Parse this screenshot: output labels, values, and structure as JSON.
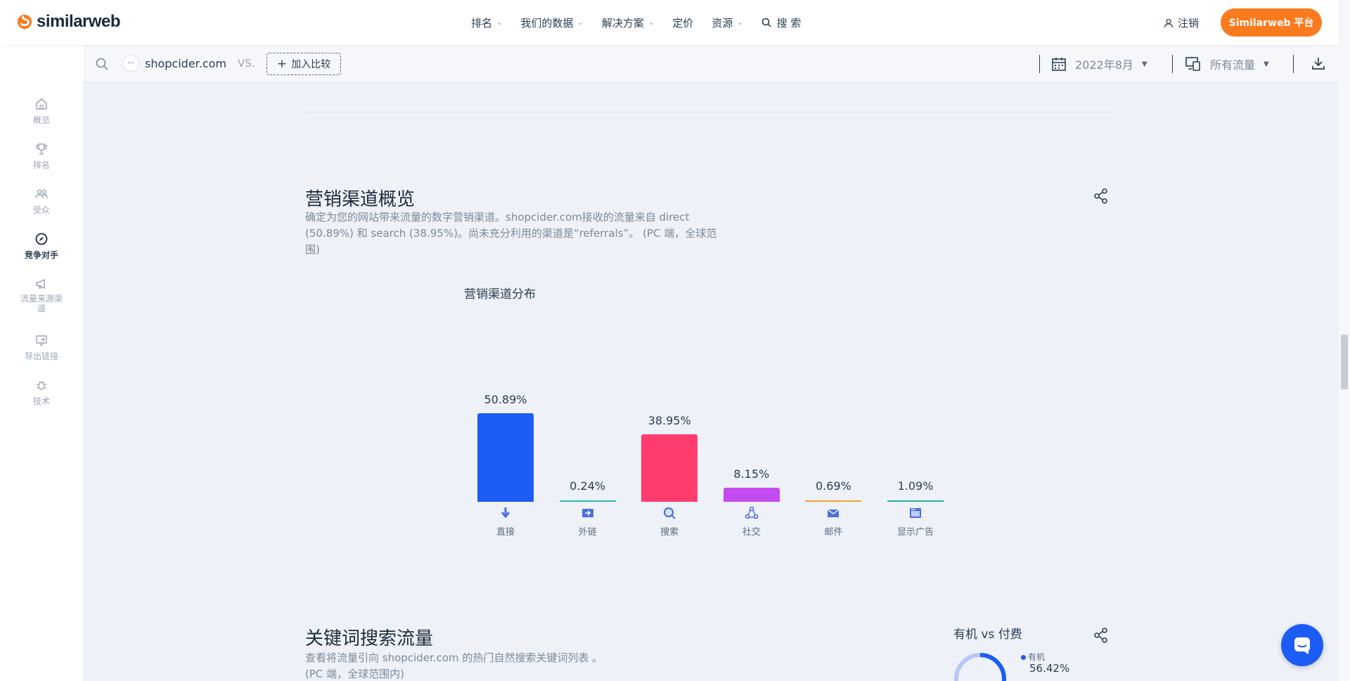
{
  "brand": {
    "logo_text": "similarweb"
  },
  "nav": {
    "items": [
      {
        "label": "排名"
      },
      {
        "label": "我们的数据"
      },
      {
        "label": "解决方案"
      },
      {
        "label": "定价"
      },
      {
        "label": "资源"
      }
    ],
    "search_label": "搜 索",
    "login_label": "注销",
    "platform_button": "Similarweb 平台"
  },
  "sidebar": {
    "items": [
      {
        "label": "概览"
      },
      {
        "label": "排名"
      },
      {
        "label": "受众"
      },
      {
        "label": "竞争对手"
      },
      {
        "label": "流量来源渠道"
      },
      {
        "label": "导出链接"
      },
      {
        "label": "技术"
      }
    ]
  },
  "subbar": {
    "site": "shopcider.com",
    "vs": "VS.",
    "add_compare": "加入比较",
    "date": "2022年8月",
    "traffic": "所有流量"
  },
  "marketing": {
    "title": "营销渠道概览",
    "desc_line1": "确定为您的网站带来流量的数字营销渠道。shopcider.com接收的流量来自 direct",
    "desc_line2": "(50.89%) 和 search (38.95%)。尚未充分利用的渠道是“referrals”。 (PC 端，全球范",
    "desc_line3": "围)",
    "chart_title": "营销渠道分布"
  },
  "chart_data": {
    "type": "bar",
    "title": "营销渠道分布",
    "categories": [
      "直接",
      "外链",
      "搜索",
      "社交",
      "邮件",
      "显示广告"
    ],
    "values": [
      50.89,
      0.24,
      38.95,
      8.15,
      0.69,
      1.09
    ],
    "value_labels": [
      "50.89%",
      "0.24%",
      "38.95%",
      "8.15%",
      "0.69%",
      "1.09%"
    ],
    "colors": [
      "#1c5cf5",
      "#2bb6b0",
      "#ff3c6e",
      "#c24bf0",
      "#f2a12f",
      "#1fb39a"
    ],
    "ylim": [
      0,
      50.89
    ]
  },
  "keywords": {
    "title": "关键词搜索流量",
    "desc_line1": "查看将流量引向 shopcider.com 的热门自然搜索关键词列表 。",
    "desc_line2": "(PC 端，全球范围内)"
  },
  "organic_paid": {
    "title": "有机 vs 付费",
    "legend": "有机",
    "value": "56.42%",
    "organic_share": 56.42
  }
}
